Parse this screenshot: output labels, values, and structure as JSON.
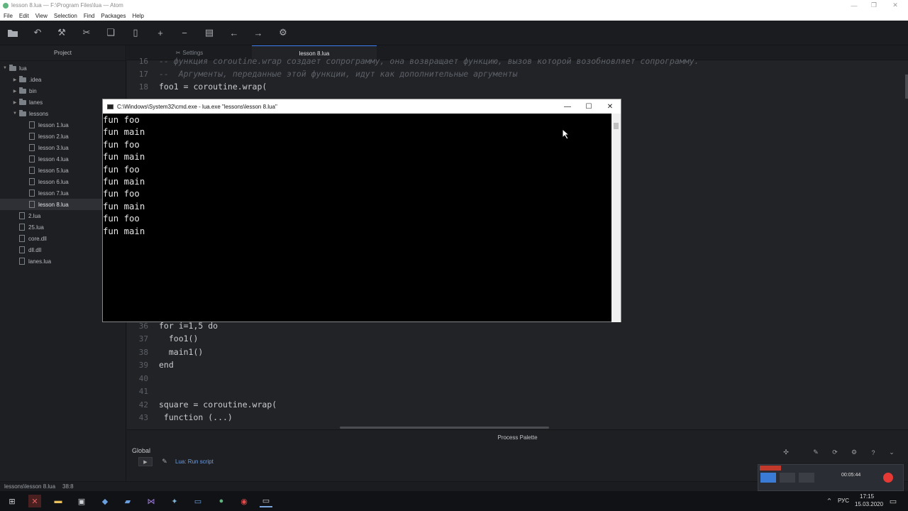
{
  "window": {
    "title": "lesson 8.lua — F:\\Program Files\\lua — Atom"
  },
  "menu": [
    "File",
    "Edit",
    "View",
    "Selection",
    "Find",
    "Packages",
    "Help"
  ],
  "toolbar_icons": [
    "folder-icon",
    "undo-icon",
    "hammer-icon",
    "tools-icon",
    "copy-icon",
    "bookmark-icon",
    "plus-icon",
    "minus-icon",
    "file-icon",
    "arrow-left-icon",
    "arrow-right-icon",
    "gear-icon"
  ],
  "tree": {
    "header": "Project",
    "items": [
      {
        "label": "lua",
        "type": "folder",
        "depth": 0,
        "open": true
      },
      {
        "label": ".idea",
        "type": "folder",
        "depth": 1,
        "open": false
      },
      {
        "label": "bin",
        "type": "folder",
        "depth": 1,
        "open": false
      },
      {
        "label": "lanes",
        "type": "folder",
        "depth": 1,
        "open": false
      },
      {
        "label": "lessons",
        "type": "folder",
        "depth": 1,
        "open": true
      },
      {
        "label": "lesson 1.lua",
        "type": "file",
        "depth": 2
      },
      {
        "label": "lesson 2.lua",
        "type": "file",
        "depth": 2
      },
      {
        "label": "lesson 3.lua",
        "type": "file",
        "depth": 2
      },
      {
        "label": "lesson 4.lua",
        "type": "file",
        "depth": 2
      },
      {
        "label": "lesson 5.lua",
        "type": "file",
        "depth": 2
      },
      {
        "label": "lesson 6.lua",
        "type": "file",
        "depth": 2
      },
      {
        "label": "lesson 7.lua",
        "type": "file",
        "depth": 2
      },
      {
        "label": "lesson 8.lua",
        "type": "file",
        "depth": 2,
        "selected": true
      },
      {
        "label": "2.lua",
        "type": "file",
        "depth": 1
      },
      {
        "label": "25.lua",
        "type": "file",
        "depth": 1
      },
      {
        "label": "core.dll",
        "type": "file",
        "depth": 1
      },
      {
        "label": "dll.dll",
        "type": "file",
        "depth": 1
      },
      {
        "label": "lanes.lua",
        "type": "file",
        "depth": 1
      }
    ]
  },
  "tabs": [
    {
      "label": "Settings",
      "active": false
    },
    {
      "label": "lesson 8.lua",
      "active": true
    }
  ],
  "editor": {
    "lines": [
      {
        "num": "16",
        "text": "-- функция coroutine.wrap создает сопрограмму, она возвращает функцию, вызов которой возобновляет сопрограмму.",
        "cls": "cmt"
      },
      {
        "num": "17",
        "text": "--  Аргументы, переданные этой функции, идут как дополнительные аргументы",
        "cls": "cmt"
      },
      {
        "num": "18",
        "text": "foo1 = coroutine.wrap(",
        "cls": ""
      },
      {
        "num": "36",
        "text": "for i=1,5 do",
        "cls": ""
      },
      {
        "num": "37",
        "text": "  foo1()",
        "cls": ""
      },
      {
        "num": "38",
        "text": "  main1()",
        "cls": ""
      },
      {
        "num": "39",
        "text": "end",
        "cls": ""
      },
      {
        "num": "40",
        "text": "",
        "cls": ""
      },
      {
        "num": "41",
        "text": "",
        "cls": ""
      },
      {
        "num": "42",
        "text": "square = coroutine.wrap(",
        "cls": ""
      },
      {
        "num": "43",
        "text": " function (...)",
        "cls": ""
      }
    ]
  },
  "console": {
    "title": "C:\\Windows\\System32\\cmd.exe - lua.exe  \"lessons\\lesson 8.lua\"",
    "output": "fun foo\nfun main\nfun foo\nfun main\nfun foo\nfun main\nfun foo\nfun main\nfun foo\nfun main"
  },
  "palette": {
    "title": "Process Palette",
    "scope": "Global",
    "command": "Lua: Run script"
  },
  "status": {
    "path": "lessons\\lesson 8.lua",
    "cursor": "38:8"
  },
  "clock": {
    "time": "17:15",
    "date": "15.03.2020",
    "lang": "РУС"
  },
  "recorder": {
    "timer": "00:05:44"
  }
}
